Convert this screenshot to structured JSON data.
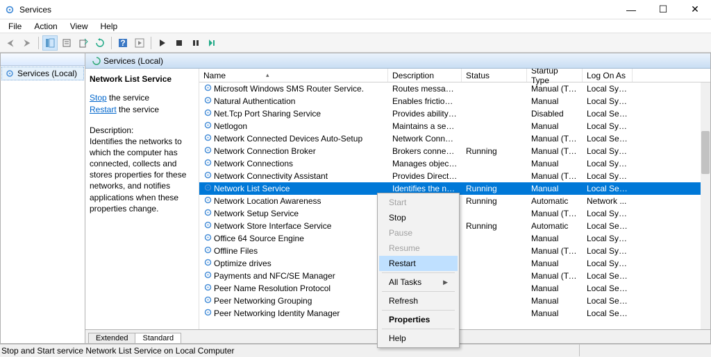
{
  "window": {
    "title": "Services"
  },
  "menubar": [
    "File",
    "Action",
    "View",
    "Help"
  ],
  "tree": {
    "root": "Services (Local)"
  },
  "rightHeader": "Services (Local)",
  "detail": {
    "name": "Network List Service",
    "stop_prefix": "Stop",
    "stop_suffix": " the service",
    "restart_prefix": "Restart",
    "restart_suffix": " the service",
    "desc_label": "Description:",
    "desc_text": "Identifies the networks to which the computer has connected, collects and stores properties for these networks, and notifies applications when these properties change."
  },
  "columns": {
    "name": "Name",
    "desc": "Description",
    "status": "Status",
    "startup": "Startup Type",
    "logon": "Log On As"
  },
  "ctx": {
    "start": "Start",
    "stop": "Stop",
    "pause": "Pause",
    "resume": "Resume",
    "restart": "Restart",
    "alltasks": "All Tasks",
    "refresh": "Refresh",
    "properties": "Properties",
    "help": "Help"
  },
  "tabs": {
    "extended": "Extended",
    "standard": "Standard"
  },
  "statusbar": "Stop and Start service Network List Service on Local Computer",
  "rows": [
    {
      "n": "Microsoft Windows SMS Router Service.",
      "d": "Routes messages...",
      "s": "",
      "t": "Manual (Tri...",
      "l": "Local Syst..."
    },
    {
      "n": "Natural Authentication",
      "d": "Enables friction-fr...",
      "s": "",
      "t": "Manual",
      "l": "Local Syst..."
    },
    {
      "n": "Net.Tcp Port Sharing Service",
      "d": "Provides ability t...",
      "s": "",
      "t": "Disabled",
      "l": "Local Serv..."
    },
    {
      "n": "Netlogon",
      "d": "Maintains a secur...",
      "s": "",
      "t": "Manual",
      "l": "Local Syst..."
    },
    {
      "n": "Network Connected Devices Auto-Setup",
      "d": "Network Connect...",
      "s": "",
      "t": "Manual (Tri...",
      "l": "Local Serv..."
    },
    {
      "n": "Network Connection Broker",
      "d": "Brokers connecti...",
      "s": "Running",
      "t": "Manual (Tri...",
      "l": "Local Syst..."
    },
    {
      "n": "Network Connections",
      "d": "Manages objects...",
      "s": "",
      "t": "Manual",
      "l": "Local Syst..."
    },
    {
      "n": "Network Connectivity Assistant",
      "d": "Provides DirectAc...",
      "s": "",
      "t": "Manual (Tri...",
      "l": "Local Syst..."
    },
    {
      "n": "Network List Service",
      "d": "Identifies the net...",
      "s": "Running",
      "t": "Manual",
      "l": "Local Serv...",
      "sel": true
    },
    {
      "n": "Network Location Awareness",
      "d": "",
      "s": "Running",
      "t": "Automatic",
      "l": "Network ..."
    },
    {
      "n": "Network Setup Service",
      "d": "u...",
      "s": "",
      "t": "Manual (Tri...",
      "l": "Local Syst..."
    },
    {
      "n": "Network Store Interface Service",
      "d": "...",
      "s": "Running",
      "t": "Automatic",
      "l": "Local Serv..."
    },
    {
      "n": "Office 64 Source Engine",
      "d": "",
      "s": "",
      "t": "Manual",
      "l": "Local Syst..."
    },
    {
      "n": "Offline Files",
      "d": "",
      "s": "",
      "t": "Manual (Tri...",
      "l": "Local Syst..."
    },
    {
      "n": "Optimize drives",
      "d": "",
      "s": "",
      "t": "Manual",
      "l": "Local Syst..."
    },
    {
      "n": "Payments and NFC/SE Manager",
      "d": "",
      "s": "",
      "t": "Manual (Tri...",
      "l": "Local Serv..."
    },
    {
      "n": "Peer Name Resolution Protocol",
      "d": "",
      "s": "",
      "t": "Manual",
      "l": "Local Serv..."
    },
    {
      "n": "Peer Networking Grouping",
      "d": "",
      "s": "",
      "t": "Manual",
      "l": "Local Serv..."
    },
    {
      "n": "Peer Networking Identity Manager",
      "d": "",
      "s": "",
      "t": "Manual",
      "l": "Local Serv..."
    }
  ]
}
